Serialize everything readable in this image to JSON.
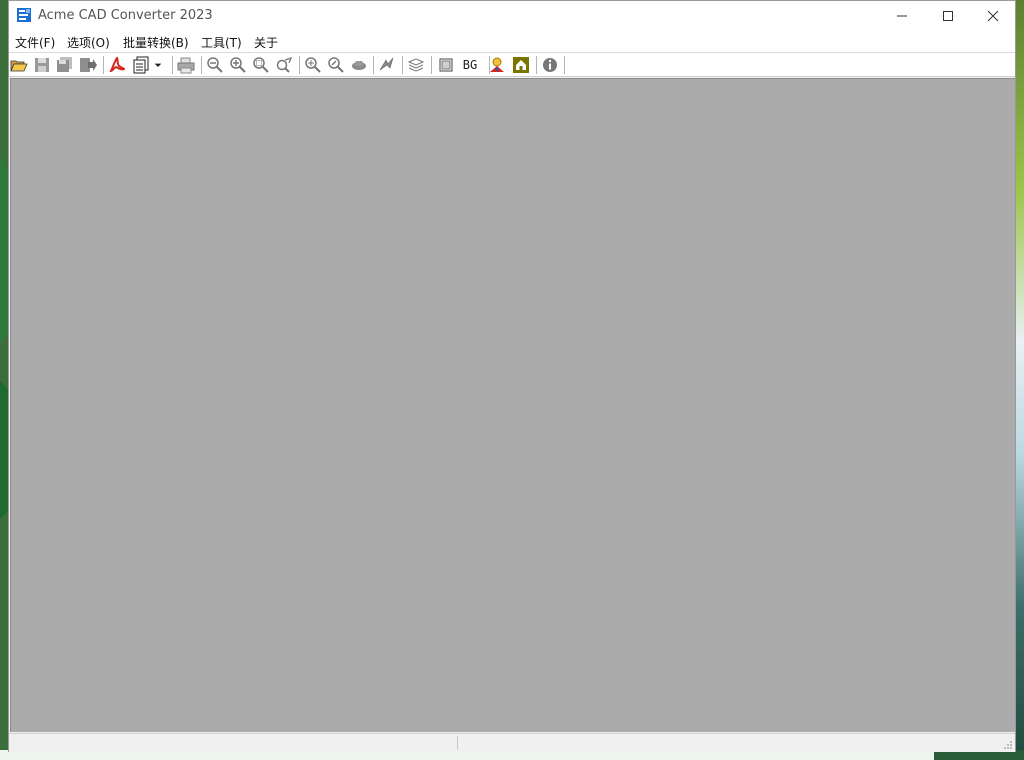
{
  "window": {
    "title": "Acme CAD Converter 2023",
    "controls": [
      "minimize",
      "maximize",
      "close"
    ]
  },
  "menu": [
    {
      "label": "文件(F)"
    },
    {
      "label": "选项(O)"
    },
    {
      "label": "批量转换(B)"
    },
    {
      "label": "工具(T)"
    },
    {
      "label": "关于"
    }
  ],
  "toolbar": {
    "bg_label": "BG",
    "icons": [
      "open-folder-icon",
      "save-icon",
      "save-all-icon",
      "export-icon",
      "pdf-icon",
      "convert-icon",
      "dropdown-arrow-icon",
      "print-icon",
      "zoom-out-icon",
      "zoom-in-icon",
      "zoom-window-icon",
      "zoom-previous-icon",
      "zoom-extent-icon",
      "zoom-realtime-icon",
      "pan-icon",
      "redraw-icon",
      "layers-icon",
      "frame-icon",
      "bg-toggle",
      "help-icon",
      "home-icon",
      "about-info-icon"
    ]
  },
  "status": {
    "left": "",
    "right": ""
  },
  "colors": {
    "canvas": "#ababab",
    "chrome": "#f0f0f0",
    "titlebar": "#ffffff"
  }
}
